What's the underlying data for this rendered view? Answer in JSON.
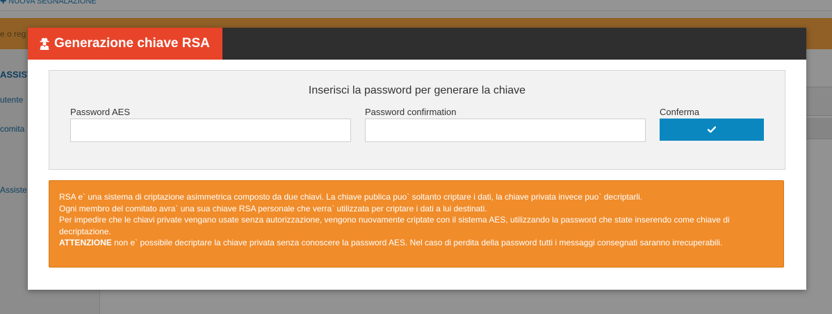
{
  "background": {
    "top_link": "✚ NUOVA SEGNALAZIONE",
    "banner_text": "e o reg",
    "sidebar_items": [
      "ASSISTE",
      "utente",
      "comita",
      "Assiste"
    ]
  },
  "modal": {
    "title": "Generazione chiave RSA",
    "title_icon": "user-secret-icon",
    "form": {
      "heading": "Inserisci la password per generare la chiave",
      "password_label": "Password AES",
      "password_value": "",
      "confirm_password_label": "Password confirmation",
      "confirm_password_value": "",
      "confirm_label": "Conferma",
      "confirm_icon": "check-icon"
    },
    "info": {
      "line1": "RSA e` una sistema di criptazione asimmetrica composto da due chiavi. La chiave publica puo` soltanto criptare i dati, la chiave privata invece puo` decriptarli.",
      "line2": "Ogni membro del comitato avra` una sua chiave RSA personale che verra` utilizzata per criptare i dati a lui destinati.",
      "line3": "Per impedire che le chiavi private vengano usate senza autorizzazione, vengono nuovamente criptate con il sistema AES, utilizzando la password che state inserendo come chiave di decriptazione.",
      "warning_label": "ATTENZIONE",
      "warning_text": " non e` possibile decriptare la chiave privata senza conoscere la password AES. Nel caso di perdita della password tutti i messaggi consegnati saranno irrecuperabili."
    }
  },
  "colors": {
    "title_tab": "#e8442a",
    "header_bar": "#2f2f2f",
    "confirm_button": "#0b87c0",
    "info_box": "#f08c2a"
  }
}
